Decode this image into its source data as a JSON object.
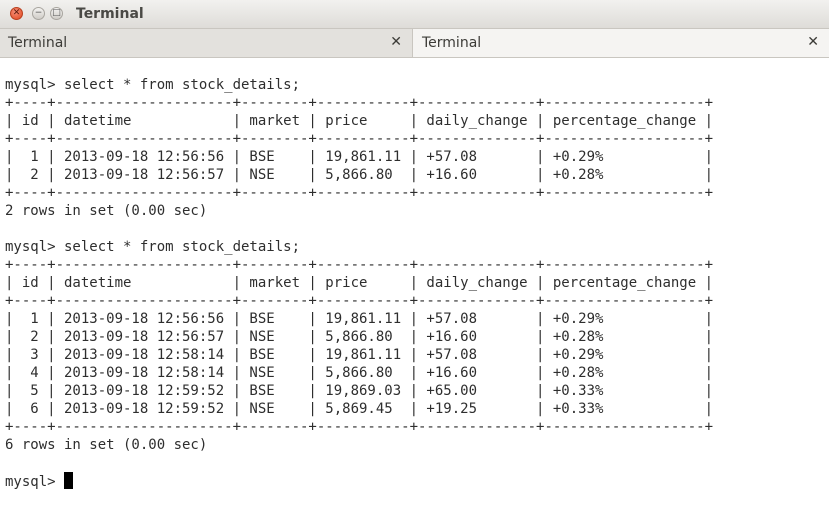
{
  "window": {
    "title": "Terminal"
  },
  "tabs": [
    {
      "label": "Terminal"
    },
    {
      "label": "Terminal"
    }
  ],
  "terminal": {
    "lines": [
      "",
      "mysql> select * from stock_details;",
      "+----+---------------------+--------+-----------+--------------+-------------------+",
      "| id | datetime            | market | price     | daily_change | percentage_change |",
      "+----+---------------------+--------+-----------+--------------+-------------------+",
      "|  1 | 2013-09-18 12:56:56 | BSE    | 19,861.11 | +57.08       | +0.29%            |",
      "|  2 | 2013-09-18 12:56:57 | NSE    | 5,866.80  | +16.60       | +0.28%            |",
      "+----+---------------------+--------+-----------+--------------+-------------------+",
      "2 rows in set (0.00 sec)",
      "",
      "mysql> select * from stock_details;",
      "+----+---------------------+--------+-----------+--------------+-------------------+",
      "| id | datetime            | market | price     | daily_change | percentage_change |",
      "+----+---------------------+--------+-----------+--------------+-------------------+",
      "|  1 | 2013-09-18 12:56:56 | BSE    | 19,861.11 | +57.08       | +0.29%            |",
      "|  2 | 2013-09-18 12:56:57 | NSE    | 5,866.80  | +16.60       | +0.28%            |",
      "|  3 | 2013-09-18 12:58:14 | BSE    | 19,861.11 | +57.08       | +0.29%            |",
      "|  4 | 2013-09-18 12:58:14 | NSE    | 5,866.80  | +16.60       | +0.28%            |",
      "|  5 | 2013-09-18 12:59:52 | BSE    | 19,869.03 | +65.00       | +0.33%            |",
      "|  6 | 2013-09-18 12:59:52 | NSE    | 5,869.45  | +19.25       | +0.33%            |",
      "+----+---------------------+--------+-----------+--------------+-------------------+",
      "6 rows in set (0.00 sec)",
      ""
    ],
    "prompt": "mysql> "
  }
}
